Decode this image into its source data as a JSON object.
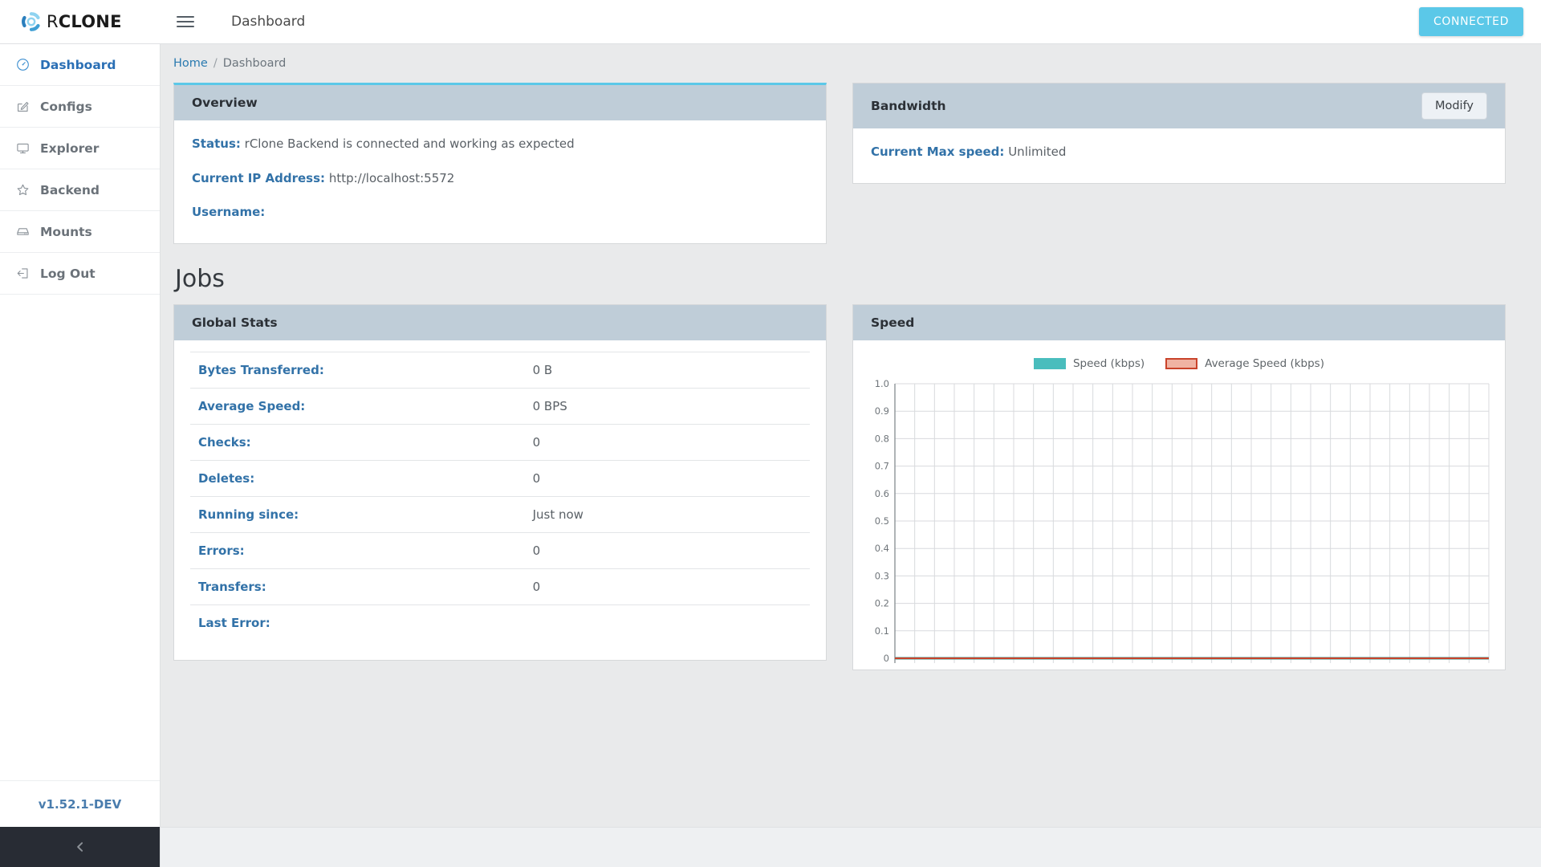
{
  "topbar": {
    "logo_prefix": "R",
    "logo_suffix": "CLONE",
    "logo_icon": "rclone-logo-icon",
    "menu_icon": "hamburger-menu-icon",
    "title": "Dashboard",
    "connected_label": "CONNECTED",
    "connected_color": "#5bc8e8"
  },
  "sidebar": {
    "items": [
      {
        "label": "Dashboard",
        "icon": "gauge-icon",
        "active": true
      },
      {
        "label": "Configs",
        "icon": "edit-square-icon",
        "active": false
      },
      {
        "label": "Explorer",
        "icon": "monitor-icon",
        "active": false
      },
      {
        "label": "Backend",
        "icon": "star-icon",
        "active": false
      },
      {
        "label": "Mounts",
        "icon": "hard-drive-icon",
        "active": false
      },
      {
        "label": "Log Out",
        "icon": "sign-out-icon",
        "active": false
      }
    ],
    "version": "v1.52.1-DEV",
    "collapse_icon": "chevron-left-icon"
  },
  "breadcrumb": {
    "home": "Home",
    "separator": "/",
    "current": "Dashboard"
  },
  "overview": {
    "title": "Overview",
    "status_label": "Status:",
    "status_value": "rClone Backend is connected and working as expected",
    "ip_label": "Current IP Address:",
    "ip_value": "http://localhost:5572",
    "username_label": "Username:",
    "username_value": ""
  },
  "bandwidth": {
    "title": "Bandwidth",
    "modify_label": "Modify",
    "max_speed_label": "Current Max speed:",
    "max_speed_value": "Unlimited"
  },
  "jobs": {
    "heading": "Jobs"
  },
  "global_stats": {
    "title": "Global Stats",
    "rows": [
      {
        "key": "Bytes Transferred:",
        "value": "0 B"
      },
      {
        "key": "Average Speed:",
        "value": "0 BPS"
      },
      {
        "key": "Checks:",
        "value": "0"
      },
      {
        "key": "Deletes:",
        "value": "0"
      },
      {
        "key": "Running since:",
        "value": "Just now"
      },
      {
        "key": "Errors:",
        "value": "0"
      },
      {
        "key": "Transfers:",
        "value": "0"
      },
      {
        "key": "Last Error:",
        "value": ""
      }
    ]
  },
  "speed_card": {
    "title": "Speed"
  },
  "chart_data": {
    "type": "line",
    "title": "Speed",
    "xlabel": "",
    "ylabel": "",
    "ylim": [
      0,
      1.0
    ],
    "ytick_labels": [
      "1.0",
      "0.9",
      "0.8",
      "0.7",
      "0.6",
      "0.5",
      "0.4",
      "0.3",
      "0.2",
      "0.1",
      "0"
    ],
    "yticks": [
      1.0,
      0.9,
      0.8,
      0.7,
      0.6,
      0.5,
      0.4,
      0.3,
      0.2,
      0.1,
      0
    ],
    "xtick_labels": [],
    "x_gridline_count": 30,
    "grid": true,
    "legend_position": "top-center",
    "series": [
      {
        "name": "Speed (kbps)",
        "color": "#49bdbd",
        "values": [
          0,
          0,
          0,
          0,
          0,
          0,
          0,
          0,
          0,
          0,
          0,
          0,
          0,
          0,
          0,
          0,
          0,
          0,
          0,
          0,
          0,
          0,
          0,
          0,
          0,
          0,
          0,
          0,
          0,
          0,
          0
        ]
      },
      {
        "name": "Average Speed (kbps)",
        "color": "#c9432b",
        "fill": "#f0b3a3",
        "values": [
          0,
          0,
          0,
          0,
          0,
          0,
          0,
          0,
          0,
          0,
          0,
          0,
          0,
          0,
          0,
          0,
          0,
          0,
          0,
          0,
          0,
          0,
          0,
          0,
          0,
          0,
          0,
          0,
          0,
          0,
          0
        ]
      }
    ]
  }
}
